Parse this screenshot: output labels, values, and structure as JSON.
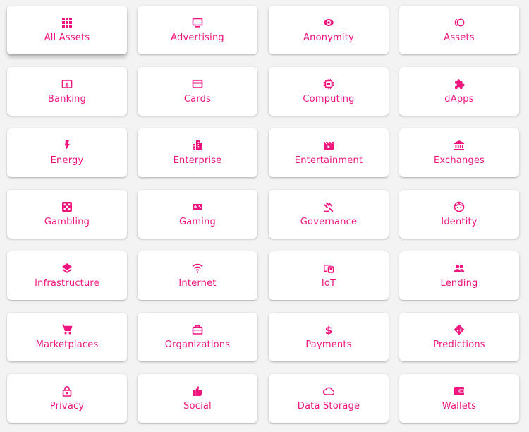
{
  "theme": {
    "accent": "#f0147f",
    "card_bg": "#ffffff",
    "page_bg": "#f3f3f3"
  },
  "categories": [
    {
      "label": "All Assets",
      "icon": "apps-grid-icon",
      "active": true
    },
    {
      "label": "Advertising",
      "icon": "monitor-icon"
    },
    {
      "label": "Anonymity",
      "icon": "eye-icon"
    },
    {
      "label": "Assets",
      "icon": "coins-icon"
    },
    {
      "label": "Banking",
      "icon": "dollar-bill-icon"
    },
    {
      "label": "Cards",
      "icon": "credit-card-icon"
    },
    {
      "label": "Computing",
      "icon": "cpu-chip-icon"
    },
    {
      "label": "dApps",
      "icon": "puzzle-icon"
    },
    {
      "label": "Energy",
      "icon": "lightning-icon"
    },
    {
      "label": "Enterprise",
      "icon": "buildings-icon"
    },
    {
      "label": "Entertainment",
      "icon": "clapperboard-icon"
    },
    {
      "label": "Exchanges",
      "icon": "bank-icon"
    },
    {
      "label": "Gambling",
      "icon": "dice-icon"
    },
    {
      "label": "Gaming",
      "icon": "gamepad-icon"
    },
    {
      "label": "Governance",
      "icon": "gavel-icon"
    },
    {
      "label": "Identity",
      "icon": "face-icon"
    },
    {
      "label": "Infrastructure",
      "icon": "layers-icon"
    },
    {
      "label": "Internet",
      "icon": "wifi-icon"
    },
    {
      "label": "IoT",
      "icon": "devices-icon"
    },
    {
      "label": "Lending",
      "icon": "people-icon"
    },
    {
      "label": "Marketplaces",
      "icon": "shopping-cart-icon"
    },
    {
      "label": "Organizations",
      "icon": "briefcase-icon"
    },
    {
      "label": "Payments",
      "icon": "dollar-sign-icon"
    },
    {
      "label": "Predictions",
      "icon": "direction-sign-icon"
    },
    {
      "label": "Privacy",
      "icon": "lock-icon"
    },
    {
      "label": "Social",
      "icon": "thumbs-up-icon"
    },
    {
      "label": "Data Storage",
      "icon": "cloud-icon"
    },
    {
      "label": "Wallets",
      "icon": "wallet-icon"
    }
  ]
}
